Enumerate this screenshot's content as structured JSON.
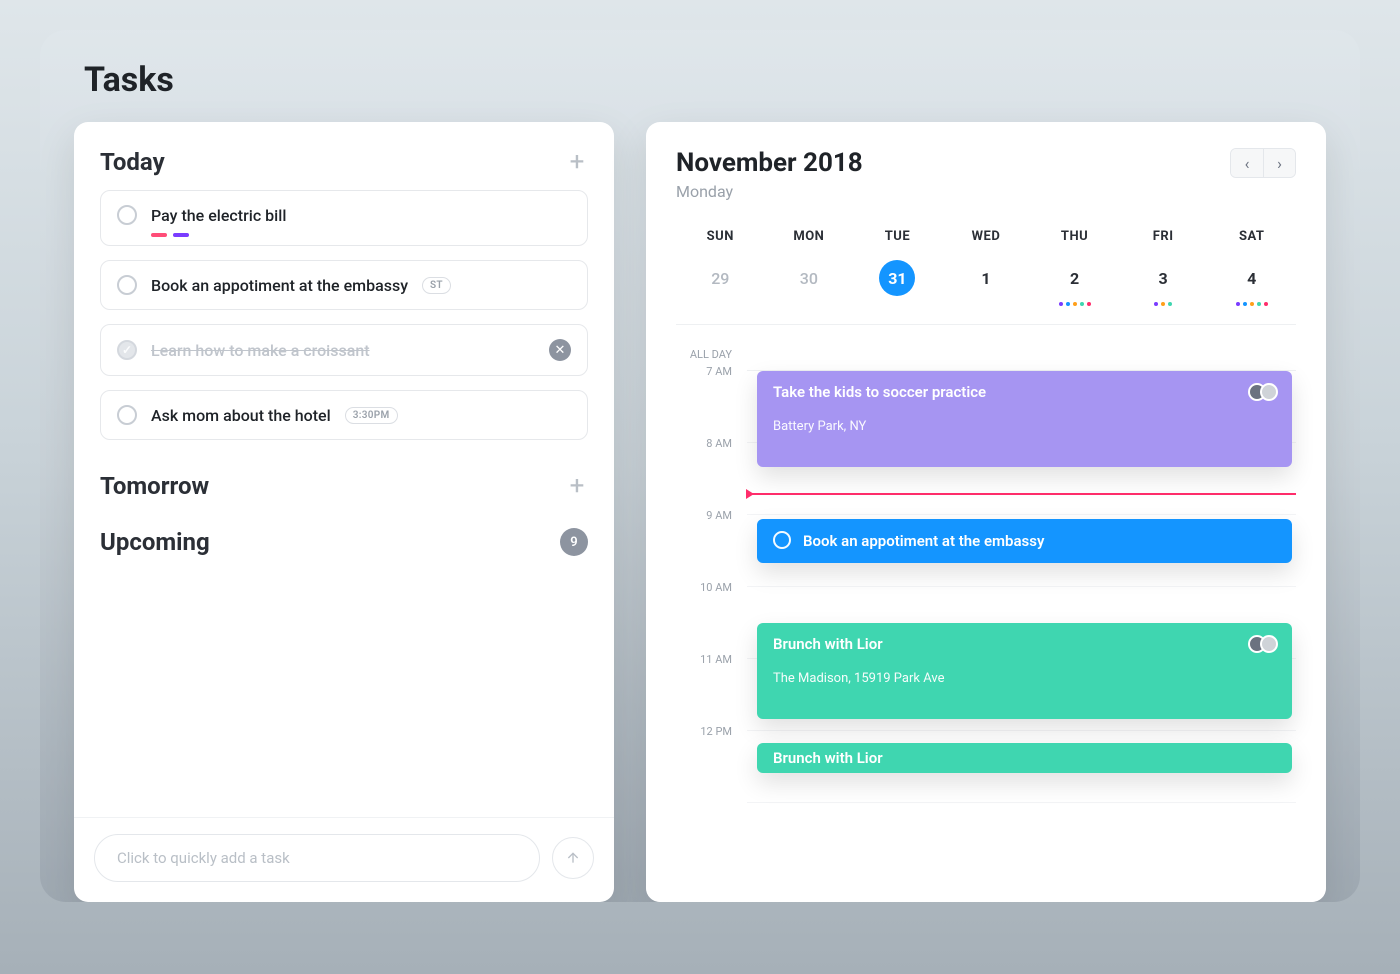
{
  "page": {
    "title": "Tasks"
  },
  "tasks": {
    "sections": {
      "today": {
        "title": "Today"
      },
      "tomorrow": {
        "title": "Tomorrow"
      },
      "upcoming": {
        "title": "Upcoming",
        "count": "9"
      }
    },
    "today_items": [
      {
        "title": "Pay the electric bill",
        "done": false,
        "tag_colors": [
          "#ff4d78",
          "#7a3cff"
        ]
      },
      {
        "title": "Book an appotiment at the embassy",
        "done": false,
        "badge": "ST"
      },
      {
        "title": "Learn how to make a croissant",
        "done": true
      },
      {
        "title": "Ask mom about the hotel",
        "done": false,
        "time_pill": "3:30PM"
      }
    ],
    "quick_add": {
      "placeholder": "Click to quickly add a task"
    }
  },
  "calendar": {
    "title": "November 2018",
    "subtitle": "Monday",
    "dow": [
      "SUN",
      "MON",
      "TUE",
      "WED",
      "THU",
      "FRI",
      "SAT"
    ],
    "dates": [
      {
        "num": "29",
        "muted": true
      },
      {
        "num": "30",
        "muted": true
      },
      {
        "num": "31",
        "selected": true
      },
      {
        "num": "1"
      },
      {
        "num": "2",
        "dots": [
          "#7a3cff",
          "#1495ff",
          "#ff9f1a",
          "#3fd6b0",
          "#ff2d6b"
        ]
      },
      {
        "num": "3",
        "dots": [
          "#7a3cff",
          "#ff9f1a",
          "#3fd6b0"
        ]
      },
      {
        "num": "4",
        "dots": [
          "#7a3cff",
          "#1495ff",
          "#ff9f1a",
          "#3fd6b0",
          "#ff2d6b"
        ]
      }
    ],
    "time_labels": {
      "allday": "ALL DAY",
      "h7": "7 AM",
      "h8": "8 AM",
      "h9": "9 AM",
      "h10": "10 AM",
      "h11": "11 AM",
      "h12": "12 PM"
    },
    "events": [
      {
        "id": "soccer",
        "color": "purple",
        "title": "Take the kids to soccer practice",
        "location": "Battery Park, NY",
        "avatars": 2
      },
      {
        "id": "embassy",
        "color": "blue",
        "title": "Book an appotiment at the embassy",
        "ring": true
      },
      {
        "id": "brunch1",
        "color": "teal",
        "title": "Brunch with Lior",
        "location": "The Madison, 15919 Park Ave",
        "avatars": 2
      },
      {
        "id": "brunch2",
        "color": "teal",
        "title": "Brunch with Lior"
      }
    ]
  }
}
